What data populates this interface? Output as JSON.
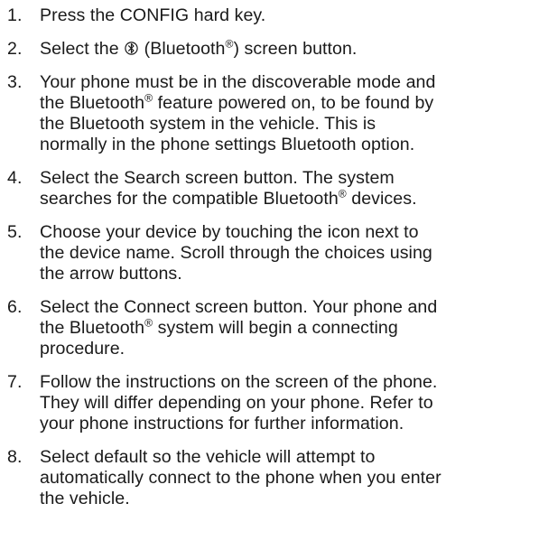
{
  "steps": [
    {
      "number": "1.",
      "lines": [
        "Press the CONFIG hard key."
      ]
    },
    {
      "number": "2.",
      "pre": "Select the",
      "icon": "bluetooth-icon",
      "mid": "(Bluetooth",
      "reg": "®",
      "post": ") screen button."
    },
    {
      "number": "3.",
      "line1": "Your phone must be in the discoverable mode and",
      "line2_pre": "the Bluetooth",
      "line2_reg": "®",
      "line2_post": " feature powered on, to be found by",
      "line3": "the Bluetooth system in the vehicle. This is",
      "line4": "normally in the phone settings Bluetooth option."
    },
    {
      "number": "4.",
      "line1": "Select the Search screen button. The system",
      "line2_pre": "searches for the compatible Bluetooth",
      "line2_reg": "®",
      "line2_post": " devices."
    },
    {
      "number": "5.",
      "lines": [
        "Choose your device by touching the icon next to",
        "the device name. Scroll through the choices using",
        "the arrow buttons."
      ]
    },
    {
      "number": "6.",
      "line1": "Select the Connect screen button. Your phone and",
      "line2_pre": "the Bluetooth",
      "line2_reg": "®",
      "line2_post": " system will begin a connecting",
      "line3": "procedure."
    },
    {
      "number": "7.",
      "lines": [
        "Follow the instructions on the screen of the phone.",
        "They will differ depending on your phone. Refer to",
        "your phone instructions for further information."
      ]
    },
    {
      "number": "8.",
      "lines": [
        "Select default so the vehicle will attempt to",
        "automatically connect to the phone when you enter",
        "the vehicle."
      ]
    }
  ]
}
